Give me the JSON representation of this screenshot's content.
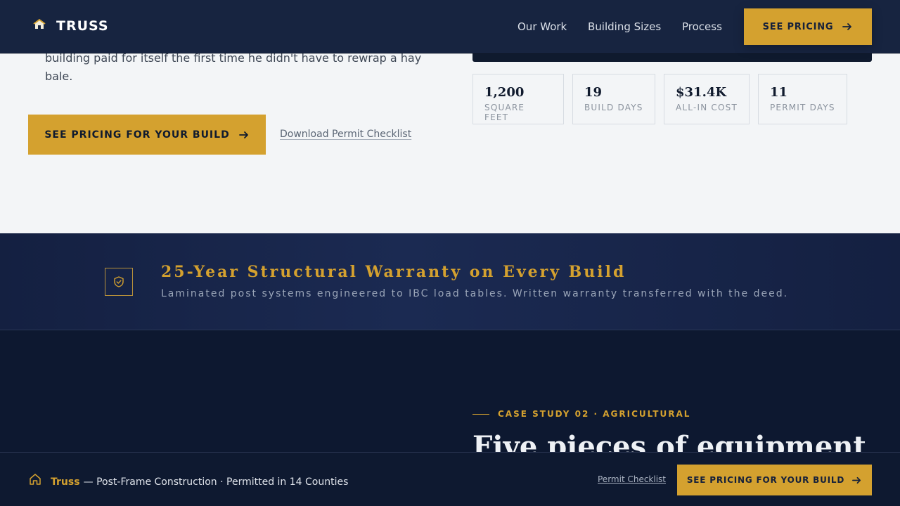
{
  "header": {
    "brand": "TRUSS",
    "nav": [
      "Our Work",
      "Building Sizes",
      "Process"
    ],
    "cta_label": "SEE PRICING"
  },
  "hero": {
    "body_lines": [
      "building paid for itself the first time he didn't have to rewrap a hay",
      "bale."
    ],
    "cta_label": "SEE PRICING FOR YOUR BUILD",
    "secondary_link": "Download Permit Checklist",
    "stats": [
      {
        "value": "1,200",
        "label": "SQUARE FEET"
      },
      {
        "value": "19",
        "label": "BUILD DAYS"
      },
      {
        "value": "$31.4K",
        "label": "ALL-IN COST"
      },
      {
        "value": "11",
        "label": "PERMIT DAYS"
      }
    ]
  },
  "warranty": {
    "title": "25-Year Structural Warranty on Every Build",
    "subtitle": "Laminated post systems engineered to IBC load tables. Written warranty transferred with the deed."
  },
  "case_study": {
    "eyebrow": "CASE STUDY 02 · AGRICULTURAL",
    "headline": "Five pieces of equipment"
  },
  "footer": {
    "brand": "Truss",
    "tagline": "— Post-Frame Construction · Permitted in 14 Counties",
    "link": "Permit Checklist",
    "cta_label": "SEE PRICING FOR YOUR BUILD"
  },
  "colors": {
    "accent": "#d4a12f",
    "navy": "#172440",
    "deep_navy": "#0d1830",
    "light_bg": "#f3f5f7"
  },
  "icons": [
    "house-logo-icon",
    "arrow-right-icon",
    "shield-check-icon",
    "home-outline-icon"
  ]
}
